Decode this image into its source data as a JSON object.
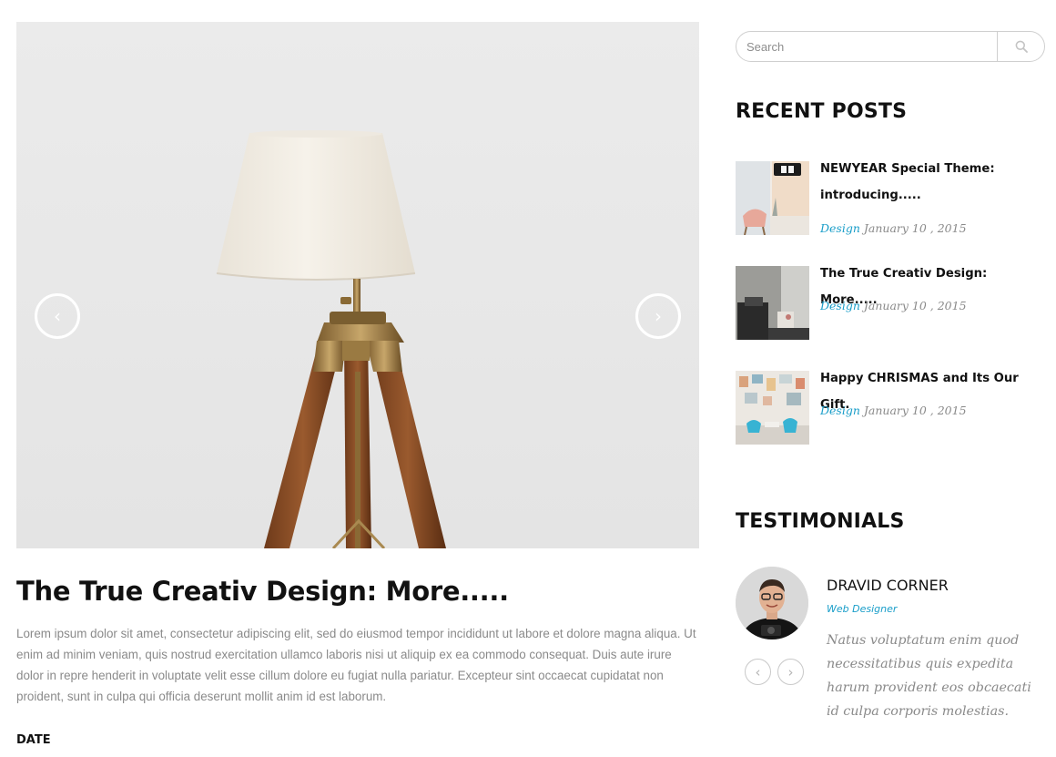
{
  "slider": {
    "prev_icon": "chevron-left-icon",
    "next_icon": "chevron-right-icon",
    "prev_glyph": "‹",
    "next_glyph": "›"
  },
  "post": {
    "title": "The True Creativ Design: More.....",
    "excerpt": "Lorem ipsum dolor sit amet, consectetur adipiscing elit, sed do eiusmod tempor incididunt ut labore et dolore magna aliqua. Ut enim ad minim veniam, quis nostrud exercitation ullamco laboris nisi ut aliquip ex ea commodo consequat. Duis aute irure dolor in repre henderit in voluptate velit esse cillum dolore eu fugiat nulla pariatur. Excepteur sint occaecat cupidatat non proident, sunt in culpa qui officia deserunt mollit anim id est laborum.",
    "meta_heading": "DATE"
  },
  "search": {
    "placeholder": "Search",
    "icon": "search-icon"
  },
  "recent_posts": {
    "heading": "RECENT POSTS",
    "items": [
      {
        "title": "NEWYEAR Special Theme: introducing.....",
        "category": "Design",
        "date": "January 10 , 2015"
      },
      {
        "title": "The True Creativ Design: More.....",
        "category": "Design",
        "date": "January 10 , 2015"
      },
      {
        "title": "Happy CHRISMAS and Its Our Gift.",
        "category": "Design",
        "date": "January 10 , 2015"
      }
    ]
  },
  "testimonials": {
    "heading": "TESTIMONIALS",
    "name": "DRAVID CORNER",
    "role": "Web Designer",
    "quote": "Natus voluptatum enim quod necessitatibus quis expedita harum provident eos obcaecati id culpa corporis molestias.",
    "prev_glyph": "‹",
    "next_glyph": "›"
  },
  "colors": {
    "accent": "#1a9ec9",
    "muted_text": "#8a8a8a",
    "heading_text": "#111111"
  }
}
